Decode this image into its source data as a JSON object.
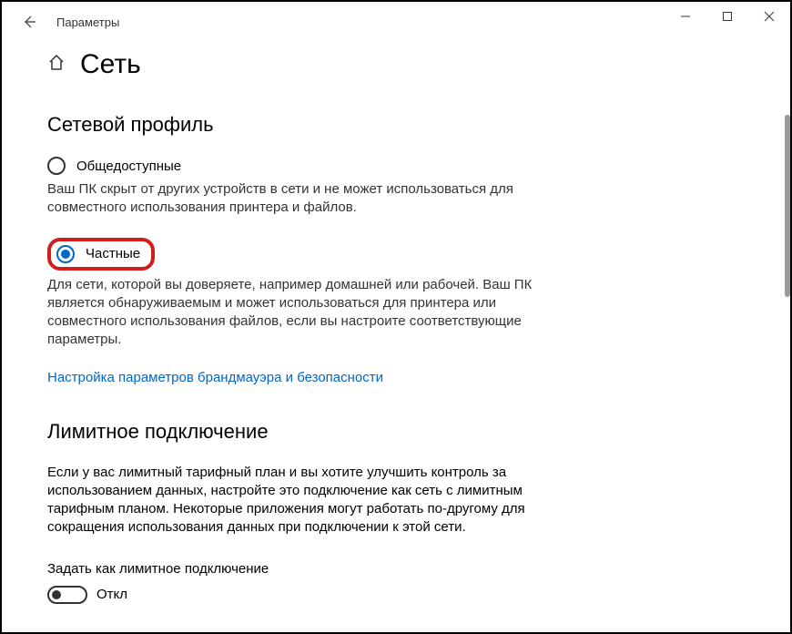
{
  "window": {
    "title": "Параметры"
  },
  "page": {
    "title": "Сеть"
  },
  "sections": {
    "profile": {
      "heading": "Сетевой профиль",
      "public": {
        "label": "Общедоступные",
        "desc": "Ваш ПК скрыт от других устройств в сети и не может использоваться для совместного использования принтера и файлов."
      },
      "private": {
        "label": "Частные",
        "desc": "Для сети, которой вы доверяете, например домашней или рабочей. Ваш ПК является обнаруживаемым и может использоваться для принтера или совместного использования файлов, если вы настроите соответствующие параметры."
      },
      "firewall_link": "Настройка параметров брандмауэра и безопасности"
    },
    "metered": {
      "heading": "Лимитное подключение",
      "desc": "Если у вас лимитный тарифный план и вы хотите улучшить контроль за использованием данных, настройте это подключение как сеть с лимитным тарифным планом. Некоторые приложения могут работать по-другому для сокращения использования данных при подключении к этой сети.",
      "toggle_label": "Задать как лимитное подключение",
      "toggle_state": "Откл"
    }
  }
}
